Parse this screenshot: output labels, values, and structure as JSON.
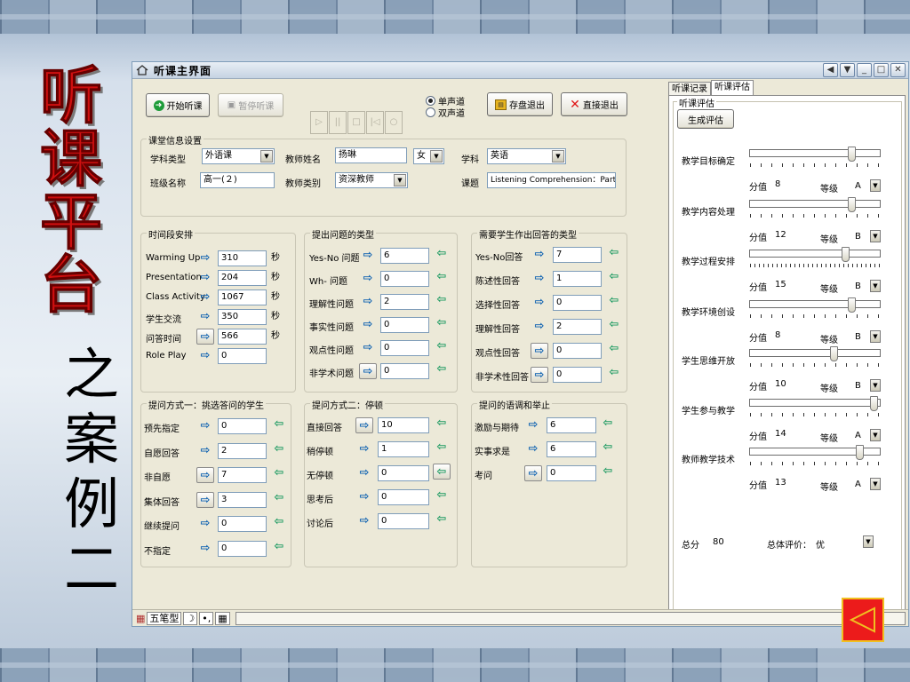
{
  "slide": {
    "title_chars": [
      "听",
      "课",
      "平",
      "台"
    ],
    "subtitle_chars": [
      "之",
      "案",
      "例",
      "二"
    ]
  },
  "window": {
    "title": "听课主界面",
    "min": "_",
    "max": "□",
    "close": "✕",
    "nav_left": "◀",
    "nav_down": "▼"
  },
  "toolbar": {
    "start": "开始听课",
    "pause": "暂停听课",
    "mono": "单声道",
    "stereo": "双声道",
    "save_exit": "存盘退出",
    "exit": "直接退出",
    "media": [
      "▷",
      "||",
      "□",
      "|◁",
      "○"
    ]
  },
  "classinfo": {
    "group": "课堂信息设置",
    "subject_type_label": "学科类型",
    "subject_type": "外语课",
    "teacher_name_label": "教师姓名",
    "teacher_name": "扬琳",
    "gender": "女",
    "subject_label": "学科",
    "subject": "英语",
    "class_label": "班级名称",
    "class_name": "高一(２)",
    "teacher_type_label": "教师类别",
    "teacher_type": "资深教师",
    "topic_label": "课题",
    "topic": "Listening Comprehension：Part-Ti"
  },
  "time": {
    "group": "时间段安排",
    "unit": "秒",
    "rows": [
      {
        "label": "Warming Up",
        "value": "310",
        "unit": true
      },
      {
        "label": "Presentation",
        "value": "204",
        "unit": true
      },
      {
        "label": "Class Activity",
        "value": "1067",
        "unit": true
      },
      {
        "label": "学生交流",
        "value": "350",
        "unit": true
      },
      {
        "label": "问答时间",
        "value": "566",
        "unit": true
      },
      {
        "label": "Role Play",
        "value": "0",
        "unit": false
      }
    ]
  },
  "qtypes": {
    "group": "提出问题的类型",
    "rows": [
      {
        "label": "Yes-No 问题",
        "value": "6"
      },
      {
        "label": "Wh- 问题",
        "value": "0"
      },
      {
        "label": "理解性问题",
        "value": "2"
      },
      {
        "label": "事实性问题",
        "value": "0"
      },
      {
        "label": "观点性问题",
        "value": "0"
      },
      {
        "label": "非学术问题",
        "value": "0"
      }
    ]
  },
  "atypes": {
    "group": "需要学生作出回答的类型",
    "rows": [
      {
        "label": "Yes-No回答",
        "value": "7"
      },
      {
        "label": "陈述性回答",
        "value": "1"
      },
      {
        "label": "选择性回答",
        "value": "0"
      },
      {
        "label": "理解性回答",
        "value": "2"
      },
      {
        "label": "观点性回答",
        "value": "0"
      },
      {
        "label": "非学术性回答",
        "value": "0"
      }
    ]
  },
  "m1": {
    "group": "提问方式一：挑选答问的学生",
    "rows": [
      {
        "label": "预先指定",
        "value": "0"
      },
      {
        "label": "自愿回答",
        "value": "2"
      },
      {
        "label": "非自愿",
        "value": "7"
      },
      {
        "label": "集体回答",
        "value": "3"
      },
      {
        "label": "继续提问",
        "value": "0"
      },
      {
        "label": "不指定",
        "value": "0"
      }
    ]
  },
  "m2": {
    "group": "提问方式二：停顿",
    "rows": [
      {
        "label": "直接回答",
        "value": "10"
      },
      {
        "label": "稍停顿",
        "value": "1"
      },
      {
        "label": "无停顿",
        "value": "0"
      },
      {
        "label": "思考后",
        "value": "0"
      },
      {
        "label": "讨论后",
        "value": "0"
      }
    ]
  },
  "tone": {
    "group": "提问的语调和举止",
    "rows": [
      {
        "label": "激励与期待",
        "value": "6"
      },
      {
        "label": "实事求是",
        "value": "6"
      },
      {
        "label": "考问",
        "value": "0"
      }
    ]
  },
  "eval": {
    "tab_record": "听课记录",
    "tab_eval": "听课评估",
    "group": "听课评估",
    "generate": "生成评估",
    "score_label": "分值",
    "grade_label": "等级",
    "items": [
      {
        "label": "教学目标确定",
        "score": "8",
        "grade": "A",
        "level": 0.79
      },
      {
        "label": "教学内容处理",
        "score": "12",
        "grade": "B",
        "level": 0.79
      },
      {
        "label": "教学过程安排",
        "score": "15",
        "grade": "B",
        "level": 0.74
      },
      {
        "label": "教学环境创设",
        "score": "8",
        "grade": "B",
        "level": 0.79
      },
      {
        "label": "学生思维开放",
        "score": "10",
        "grade": "B",
        "level": 0.65
      },
      {
        "label": "学生参与教学",
        "score": "14",
        "grade": "A",
        "level": 0.97
      },
      {
        "label": "教师教学技术",
        "score": "13",
        "grade": "A",
        "level": 0.86
      }
    ],
    "total_label": "总分",
    "total": "80",
    "overall_label": "总体评价：",
    "overall": "优"
  },
  "status": {
    "ime": "五笔型",
    "moon": "☽",
    "dots": "•,",
    "kbd": "▦"
  },
  "colors": {
    "title_red": "#d01010",
    "back_red": "#ec1b1b",
    "back_border": "#f0c020"
  }
}
